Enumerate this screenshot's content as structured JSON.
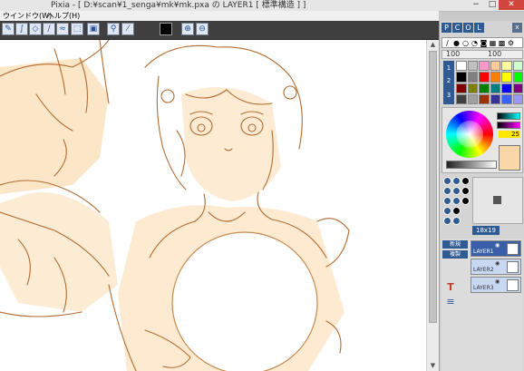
{
  "window": {
    "title": "Pixia  - [ D:¥scan¥1_senga¥mk¥mk.pxa の LAYER1 [ 標準構造 ] ]",
    "minimize_glyph": "−",
    "maximize_glyph": "□",
    "close_glyph": "✕"
  },
  "menu": {
    "items": [
      {
        "label": "ウインドウ(W)"
      },
      {
        "label": "ヘルプ(H)"
      }
    ]
  },
  "toolbar": {
    "tools": [
      {
        "icon": "pencil-icon",
        "glyph": "✎"
      },
      {
        "icon": "curve-icon",
        "glyph": "∫"
      },
      {
        "icon": "eraser-icon",
        "glyph": "◇"
      },
      {
        "icon": "brush-icon",
        "glyph": "∕"
      },
      {
        "icon": "smudge-icon",
        "glyph": "≈"
      },
      {
        "icon": "select-icon",
        "glyph": "⬚"
      },
      {
        "icon": "fill-icon",
        "glyph": "▣"
      },
      {
        "icon": "picker-icon",
        "glyph": "⚲"
      },
      {
        "icon": "line-icon",
        "glyph": "⁄"
      },
      {
        "icon": "zoom-in-icon",
        "glyph": "⊕"
      },
      {
        "icon": "zoom-out-icon",
        "glyph": "⊖"
      }
    ],
    "current_color": "#000000"
  },
  "panel": {
    "tabs": [
      "P",
      "C",
      "O",
      "L"
    ],
    "close_glyph": "x",
    "brush_slider": {
      "value1": "100",
      "value2": "100"
    },
    "palette": {
      "tab_numbers": [
        "1",
        "2",
        "3"
      ],
      "colors": [
        "#ffffff",
        "#c0c0c0",
        "#ff99cc",
        "#ffcc99",
        "#ffff99",
        "#ccffcc",
        "#000000",
        "#808080",
        "#ff0000",
        "#ff8000",
        "#ffff00",
        "#00ff00",
        "#800000",
        "#808000",
        "#008000",
        "#008080",
        "#0000ff",
        "#800080",
        "#404040",
        "#a0a0a0",
        "#993300",
        "#333399",
        "#3366ff",
        "#9999ff"
      ]
    },
    "color_picker": {
      "y_value": "25",
      "current_color": "#f9d7a8"
    },
    "brush_size": "18x19",
    "layers": {
      "buttons": [
        "新規",
        "複製"
      ],
      "rows": [
        {
          "name": "LAYER1",
          "active": true
        },
        {
          "name": "LAYER2",
          "active": false
        },
        {
          "name": "LAYER3",
          "active": false
        }
      ]
    },
    "bottom_tools": [
      "T",
      "≡"
    ]
  }
}
